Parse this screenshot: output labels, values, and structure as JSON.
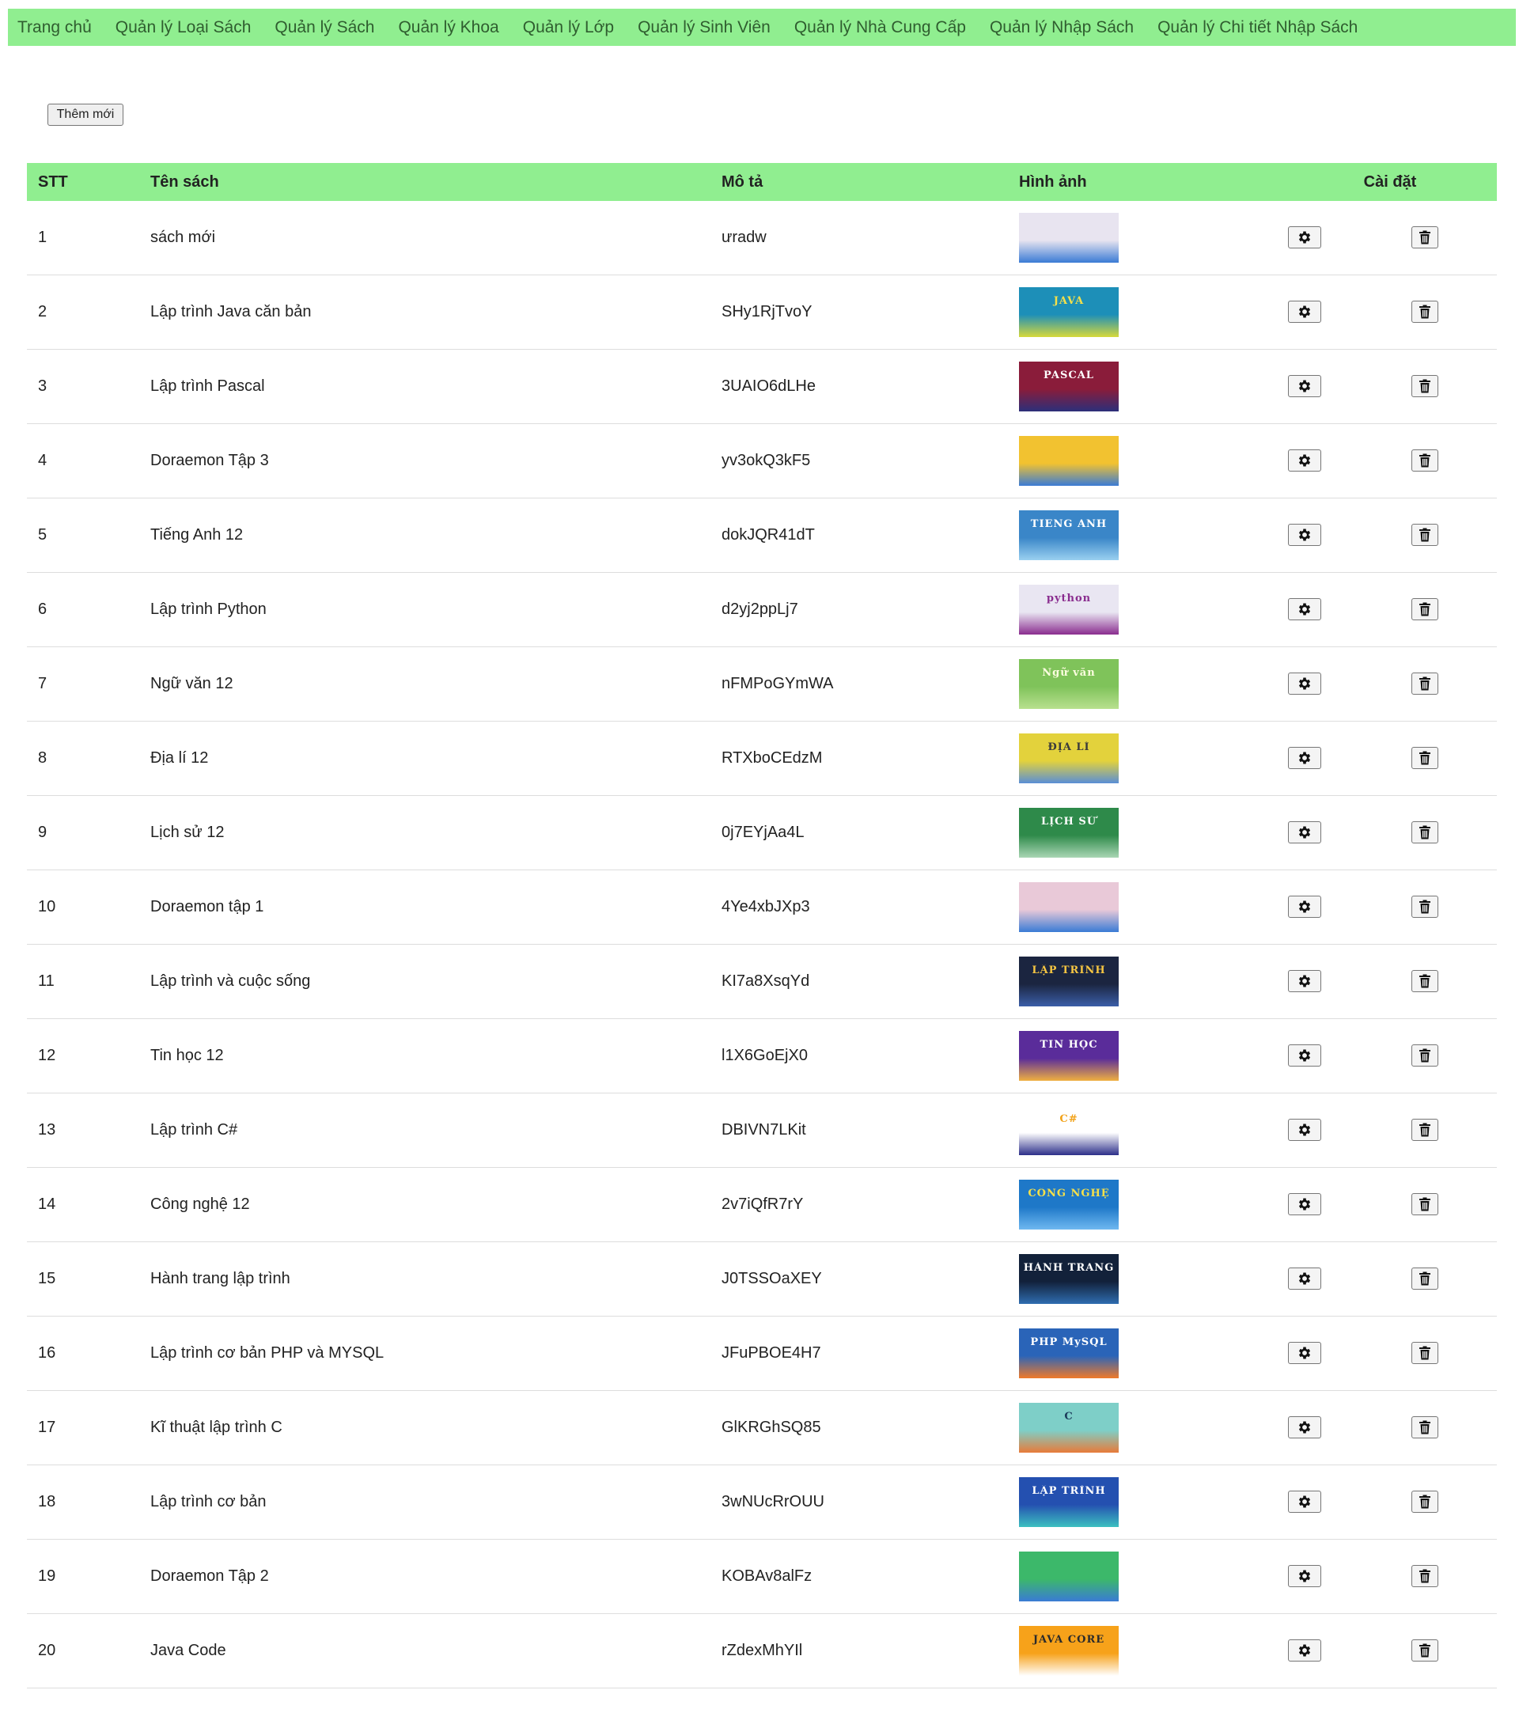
{
  "nav": {
    "items": [
      {
        "label": "Trang chủ"
      },
      {
        "label": "Quản lý Loại Sách"
      },
      {
        "label": "Quản lý Sách"
      },
      {
        "label": "Quản lý Khoa"
      },
      {
        "label": "Quản lý Lớp"
      },
      {
        "label": "Quản lý Sinh Viên"
      },
      {
        "label": "Quản lý Nhà Cung Cấp"
      },
      {
        "label": "Quản lý Nhập Sách"
      },
      {
        "label": "Quản lý Chi tiết Nhập Sách"
      }
    ]
  },
  "toolbar": {
    "add_label": "Thêm mới"
  },
  "table": {
    "headers": {
      "stt": "STT",
      "name": "Tên sách",
      "desc": "Mô tả",
      "image": "Hình ảnh",
      "settings": "Cài đặt"
    },
    "rows": [
      {
        "stt": "1",
        "name": "sách mới",
        "desc": "ưradw",
        "cover": {
          "text": "",
          "bg": "#e8e4f0",
          "accent": "#3a7bd5",
          "fg": "#e23b3b"
        }
      },
      {
        "stt": "2",
        "name": "Lập trình Java căn bản",
        "desc": "SHy1RjTvoY",
        "cover": {
          "text": "JAVA",
          "bg": "#1d8fb8",
          "accent": "#d7d93a",
          "fg": "#f5e04a"
        }
      },
      {
        "stt": "3",
        "name": "Lập trình Pascal",
        "desc": "3UAIO6dLHe",
        "cover": {
          "text": "PASCAL",
          "bg": "#8a1c3a",
          "accent": "#2b2f7a",
          "fg": "#ffffff"
        }
      },
      {
        "stt": "4",
        "name": "Doraemon Tập 3",
        "desc": "yv3okQ3kF5",
        "cover": {
          "text": "",
          "bg": "#f2c230",
          "accent": "#3a7bd5",
          "fg": "#e23b3b"
        }
      },
      {
        "stt": "5",
        "name": "Tiếng Anh 12",
        "desc": "dokJQR41dT",
        "cover": {
          "text": "TIENG ANH",
          "bg": "#3a86c8",
          "accent": "#9ad0f0",
          "fg": "#ffffff"
        }
      },
      {
        "stt": "6",
        "name": "Lập trình Python",
        "desc": "d2yj2ppLj7",
        "cover": {
          "text": "python",
          "bg": "#e9e6f2",
          "accent": "#8a2d8f",
          "fg": "#8a2d8f"
        }
      },
      {
        "stt": "7",
        "name": "Ngữ văn 12",
        "desc": "nFMPoGYmWA",
        "cover": {
          "text": "Ngữ văn",
          "bg": "#7fc35a",
          "accent": "#b8e08f",
          "fg": "#fdfde0"
        }
      },
      {
        "stt": "8",
        "name": "Địa lí 12",
        "desc": "RTXboCEdzM",
        "cover": {
          "text": "ĐỊA LÍ",
          "bg": "#e3d23c",
          "accent": "#5a8ed6",
          "fg": "#3b3b3b"
        }
      },
      {
        "stt": "9",
        "name": "Lịch sử 12",
        "desc": "0j7EYjAa4L",
        "cover": {
          "text": "LỊCH SỬ",
          "bg": "#2e8a4a",
          "accent": "#a9d6b4",
          "fg": "#ffffff"
        }
      },
      {
        "stt": "10",
        "name": "Doraemon tập 1",
        "desc": "4Ye4xbJXp3",
        "cover": {
          "text": "",
          "bg": "#e9c9d8",
          "accent": "#3a7bd5",
          "fg": "#e23b3b"
        }
      },
      {
        "stt": "11",
        "name": "Lập trình và cuộc sống",
        "desc": "KI7a8XsqYd",
        "cover": {
          "text": "LẬP TRÌNH",
          "bg": "#1b2540",
          "accent": "#3b5ea8",
          "fg": "#f5c542"
        }
      },
      {
        "stt": "12",
        "name": "Tin học 12",
        "desc": "l1X6GoEjX0",
        "cover": {
          "text": "TIN HỌC",
          "bg": "#5a2c9a",
          "accent": "#f0b040",
          "fg": "#ffffff"
        }
      },
      {
        "stt": "13",
        "name": "Lập trình C#",
        "desc": "DBIVN7LKit",
        "cover": {
          "text": "C#",
          "bg": "#ffffff",
          "accent": "#2d2f8a",
          "fg": "#f2a218"
        }
      },
      {
        "stt": "14",
        "name": "Công nghệ 12",
        "desc": "2v7iQfR7rY",
        "cover": {
          "text": "CÔNG NGHỆ",
          "bg": "#1e78c8",
          "accent": "#6fb8f0",
          "fg": "#f5e04a"
        }
      },
      {
        "stt": "15",
        "name": "Hành trang lập trình",
        "desc": "J0TSSOaXEY",
        "cover": {
          "text": "HÀNH TRANG",
          "bg": "#12213a",
          "accent": "#2f6db0",
          "fg": "#ffffff"
        }
      },
      {
        "stt": "16",
        "name": "Lập trình cơ bản PHP và MYSQL",
        "desc": "JFuPBOE4H7",
        "cover": {
          "text": "PHP MySQL",
          "bg": "#2a64b8",
          "accent": "#f07a2a",
          "fg": "#ffffff"
        }
      },
      {
        "stt": "17",
        "name": "Kĩ thuật lập trình C",
        "desc": "GlKRGhSQ85",
        "cover": {
          "text": "C",
          "bg": "#7ecfc8",
          "accent": "#e87a3a",
          "fg": "#1b3b5a"
        }
      },
      {
        "stt": "18",
        "name": "Lập trình cơ bản",
        "desc": "3wNUcRrOUU",
        "cover": {
          "text": "LẬP TRÌNH",
          "bg": "#2450b0",
          "accent": "#3cc0c0",
          "fg": "#ffffff"
        }
      },
      {
        "stt": "19",
        "name": "Doraemon Tập 2",
        "desc": "KOBAv8alFz",
        "cover": {
          "text": "",
          "bg": "#3cb86a",
          "accent": "#3a7bd5",
          "fg": "#e23b3b"
        }
      },
      {
        "stt": "20",
        "name": "Java Code",
        "desc": "rZdexMhYIl",
        "cover": {
          "text": "JAVA CORE",
          "bg": "#f7a21a",
          "accent": "#ffffff",
          "fg": "#2b2b2b"
        }
      }
    ]
  },
  "icons": {
    "edit": "gear-icon",
    "delete": "trash-icon"
  },
  "colors": {
    "nav_bg": "#90ee90",
    "header_bg": "#90ee90",
    "row_border": "#dddddd"
  }
}
